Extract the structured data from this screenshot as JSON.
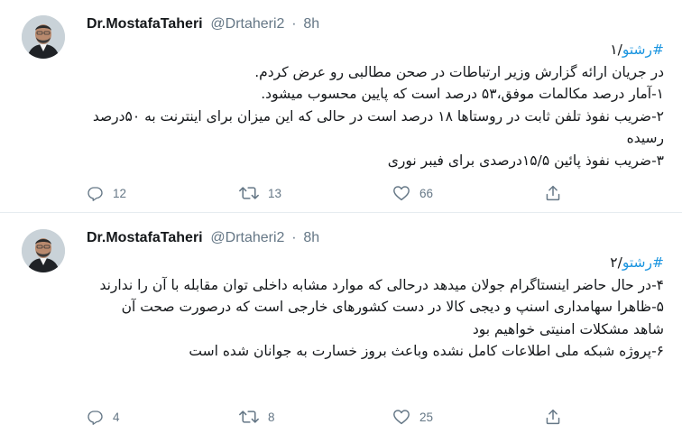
{
  "tweets": [
    {
      "author_name": "Dr.MostafaTaheri",
      "handle": "@Drtaheri2",
      "separator": "·",
      "time": "8h",
      "hashtag": "#رشتو",
      "thread_index": "/۱",
      "lines": [
        "در جریان ارائه گزارش وزیر ارتباطات در صحن مطالبی رو عرض کردم.",
        "۱-آمار درصد مکالمات موفق،۵۳ درصد است که پایین محسوب میشود.",
        "۲-ضریب نفوذ تلفن ثابت در روستاها ۱۸ درصد است در حالی که این میزان برای اینترنت به ۵۰درصد رسیده",
        "۳-ضریب نفوذ پائین ۱۵/۵درصدی برای فیبر نوری"
      ],
      "replies": "12",
      "retweets": "13",
      "likes": "66"
    },
    {
      "author_name": "Dr.MostafaTaheri",
      "handle": "@Drtaheri2",
      "separator": "·",
      "time": "8h",
      "hashtag": "#رشتو",
      "thread_index": "/۲",
      "lines": [
        "۴-در حال حاضر اینستاگرام جولان میدهد درحالی که موارد مشابه داخلی توان مقابله با آن را ندارند",
        "۵-ظاهرا سهامداری اسنپ و دیجی کالا در دست کشورهای خارجی است که درصورت صحت آن شاهد مشکلات امنیتی خواهیم بود",
        "۶-پروژه شبکه ملی اطلاعات کامل نشده وباعث بروز خسارت به جوانان شده است"
      ],
      "replies": "4",
      "retweets": "8",
      "likes": "25"
    }
  ],
  "colors": {
    "hashtag": "#1b95e0",
    "muted": "#657786",
    "divider": "#e6ecf0"
  },
  "icons": [
    "reply-icon",
    "retweet-icon",
    "like-icon",
    "share-icon"
  ]
}
